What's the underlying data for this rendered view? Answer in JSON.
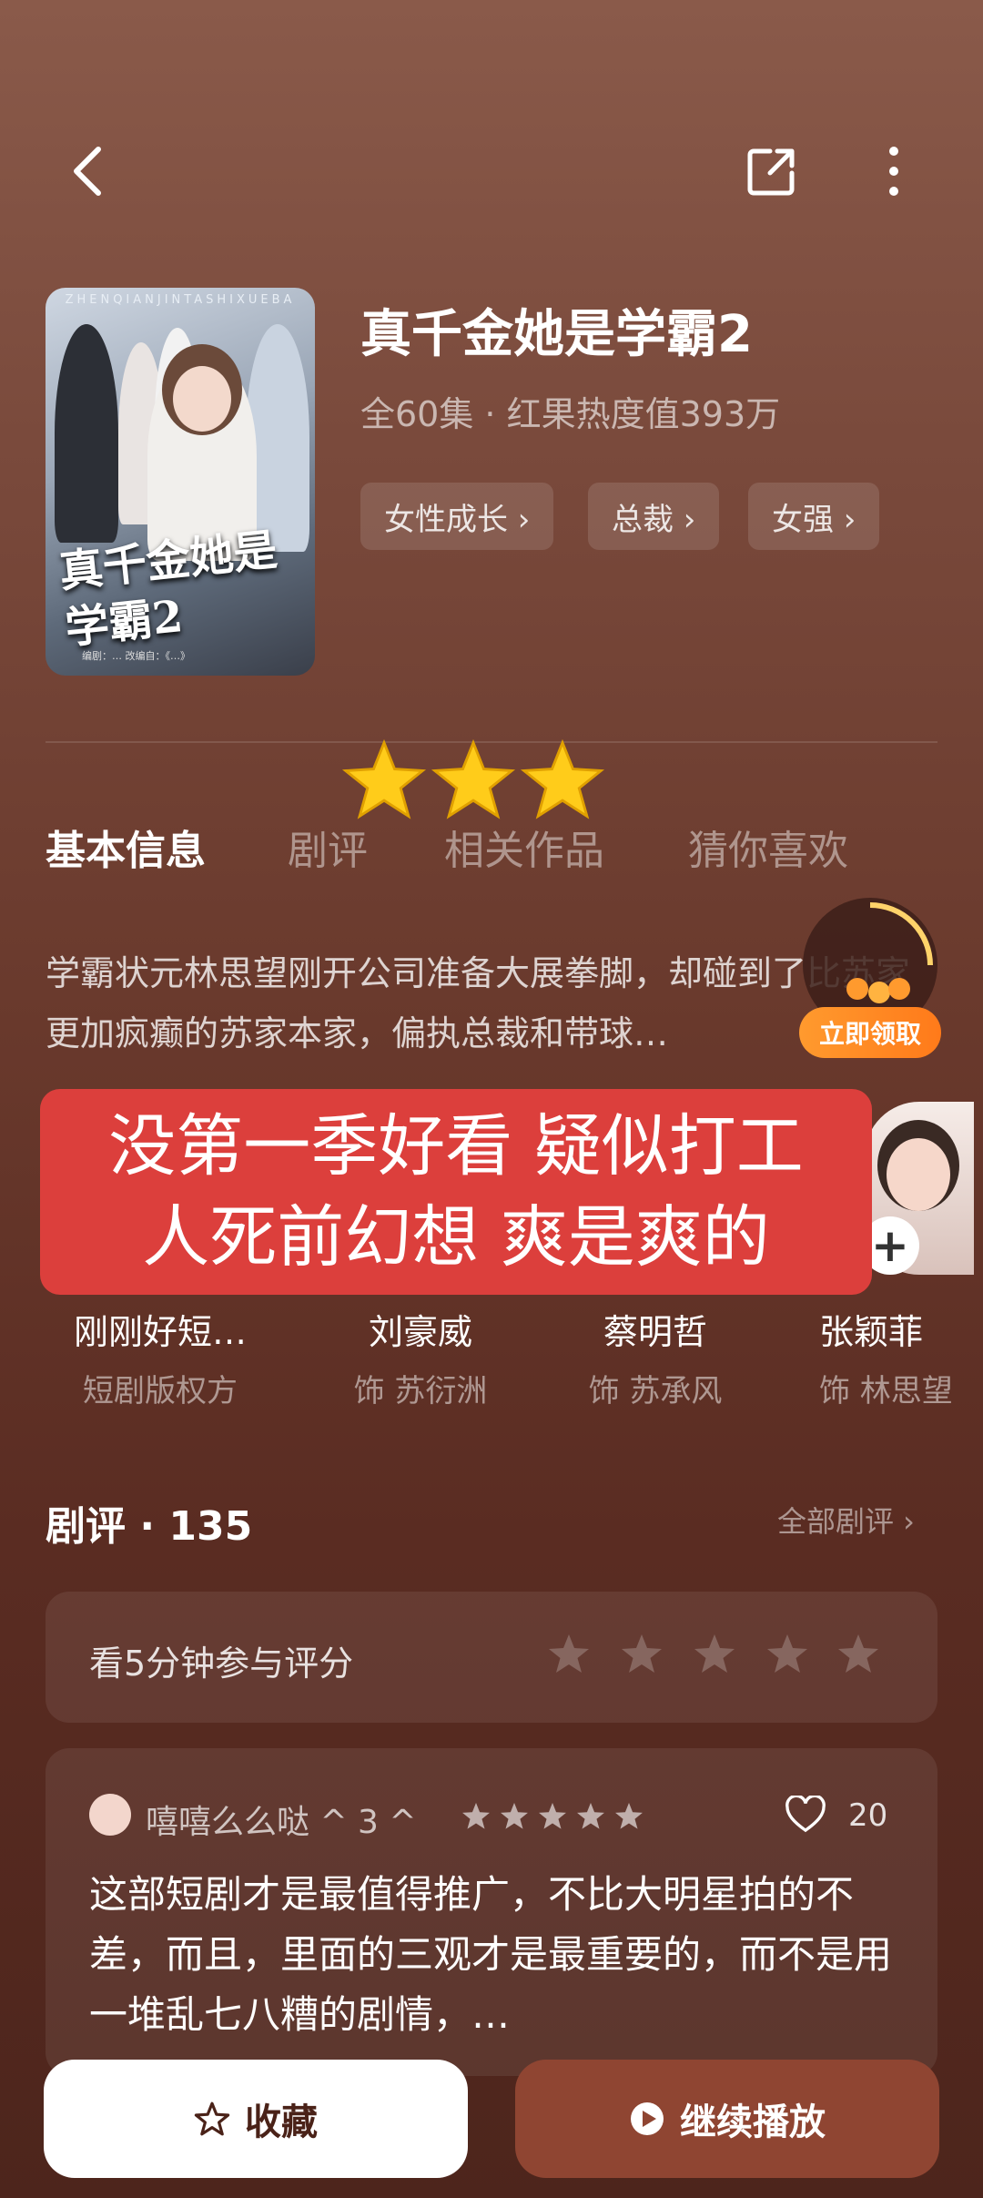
{
  "header": {
    "back_icon": "chevron-left-icon",
    "share_icon": "share-icon",
    "more_icon": "more-vertical-icon"
  },
  "drama": {
    "poster_title": "真千金她是学霸2",
    "poster_strip": "ZHENQIANJINTASHIXUEBA",
    "poster_footer": "编剧：… 改编自：《…》",
    "title": "真千金她是学霸2",
    "subtitle": "全60集 · 红果热度值393万",
    "tags": [
      "女性成长 ›",
      "总裁 ›",
      "女强 ›"
    ]
  },
  "tabs": [
    "基本信息",
    "剧评",
    "相关作品",
    "猜你喜欢"
  ],
  "description": "学霸状元林思望刚开公司准备大展拳脚，却碰到了比苏家更加疯癫的苏家本家，偏执总裁和带球…",
  "reward": {
    "claim_label": "立即领取"
  },
  "overlay_caption": {
    "line1": "没第一季好看 疑似打工",
    "line2": "人死前幻想 爽是爽的"
  },
  "cast": [
    {
      "name": "刚刚好短…",
      "role": "短剧版权方"
    },
    {
      "name": "刘豪威",
      "role": "饰 苏衍洲"
    },
    {
      "name": "蔡明哲",
      "role": "饰 苏承风"
    },
    {
      "name": "张颖菲",
      "role": "饰 林思望"
    }
  ],
  "reviews_section": {
    "title": "剧评 · 135",
    "all_label": "全部剧评 ›",
    "rate_prompt": "看5分钟参与评分",
    "rate_stars": 5
  },
  "review": {
    "user": "嘻嘻么么哒 ^ 3 ^",
    "rating": 5,
    "likes": "20",
    "text": "这部短剧才是最值得推广，不比大明星拍的不差，而且，里面的三观才是最重要的，而不是用一堆乱七八糟的剧情，…"
  },
  "actions": {
    "favorite_label": "收藏",
    "play_label": "继续播放"
  },
  "colors": {
    "overlay_red": "#dc3f3c",
    "play_button": "#8f4532",
    "claim_orange": "#ff8a24",
    "star_gold": "#ffcc1a"
  }
}
